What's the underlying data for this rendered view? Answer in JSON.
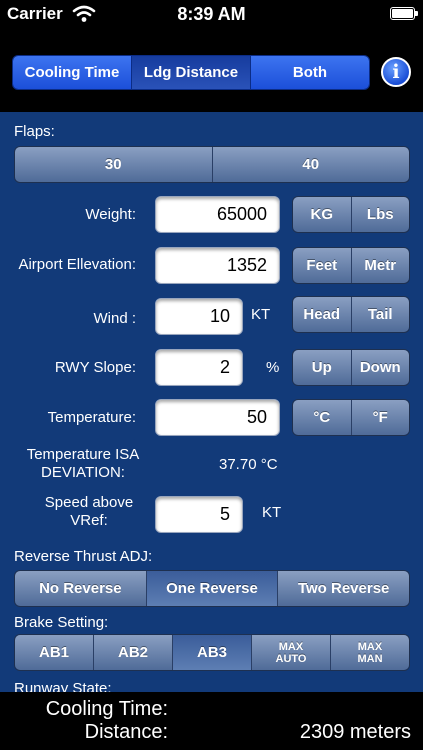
{
  "status_bar": {
    "carrier": "Carrier",
    "time": "8:39 AM",
    "wifi_icon": "wifi-icon",
    "battery_icon": "battery-icon"
  },
  "nav": {
    "segments": [
      "Cooling Time",
      "Ldg Distance",
      "Both"
    ],
    "selected": "Ldg Distance",
    "info_label": "i"
  },
  "form": {
    "flaps": {
      "label": "Flaps:",
      "options": [
        "30",
        "40"
      ]
    },
    "weight": {
      "label": "Weight:",
      "value": "65000",
      "units": [
        "KG",
        "Lbs"
      ]
    },
    "airport_elevation": {
      "label": "Airport Ellevation:",
      "value": "1352",
      "units": [
        "Feet",
        "Metr"
      ]
    },
    "wind": {
      "label": "Wind :",
      "value": "10",
      "unit": "KT",
      "options": [
        "Head",
        "Tail"
      ]
    },
    "rwy_slope": {
      "label": "RWY Slope:",
      "value": "2",
      "unit": "%",
      "options": [
        "Up",
        "Down"
      ]
    },
    "temperature": {
      "label": "Temperature:",
      "value": "50",
      "units": [
        "°C",
        "°F"
      ]
    },
    "isa_deviation": {
      "label_line1": "Temperature ISA",
      "label_line2": "DEVIATION:",
      "value": "37.70 °C"
    },
    "speed_above_vref": {
      "label_line1": "Speed above",
      "label_line2": "VRef:",
      "value": "5",
      "unit": "KT"
    },
    "reverse_thrust": {
      "label": "Reverse Thrust ADJ:",
      "options": [
        "No Reverse",
        "One Reverse",
        "Two Reverse"
      ]
    },
    "brake_setting": {
      "label": "Brake Setting:",
      "options": [
        "AB1",
        "AB2",
        "AB3"
      ],
      "max_auto_line1": "MAX",
      "max_auto_line2": "AUTO",
      "max_man_line1": "MAX",
      "max_man_line2": "MAN"
    },
    "runway_state": {
      "label": "Runway  State:"
    }
  },
  "results": {
    "cooling_time_label": "Cooling Time:",
    "cooling_time_value": "",
    "distance_label": "Distance:",
    "distance_value": "2309 meters"
  }
}
